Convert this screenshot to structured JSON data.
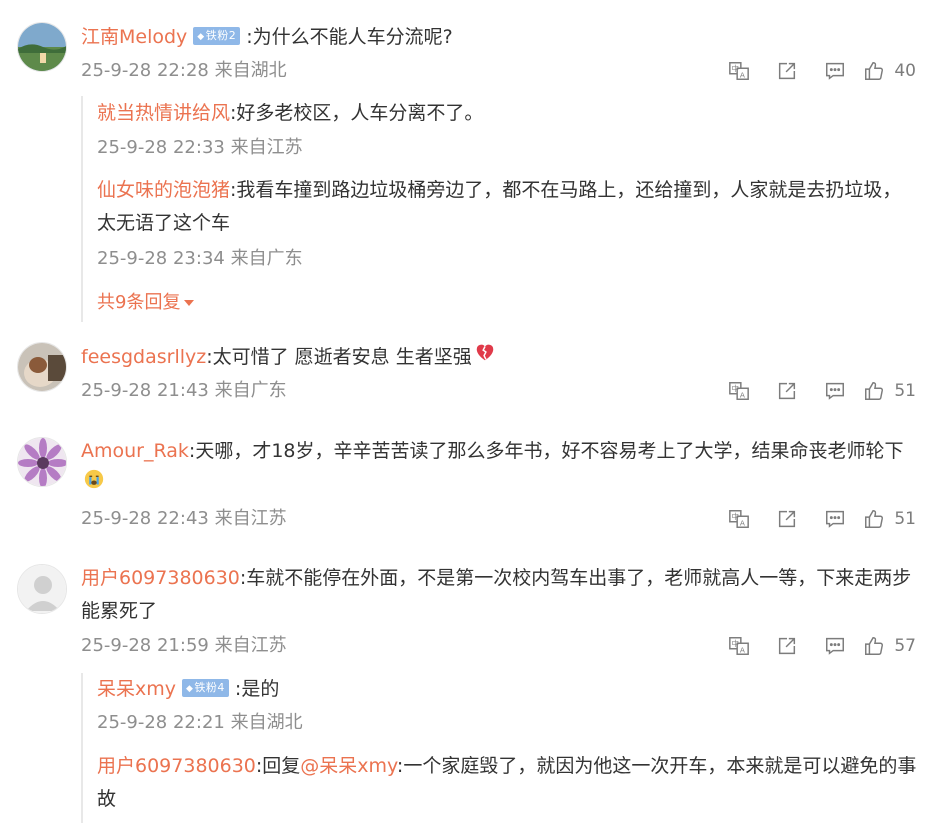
{
  "comments": [
    {
      "user": "江南Melody",
      "badge": "铁粉2",
      "text": ":为什么不能人车分流呢?",
      "time": "25-9-28 22:28",
      "location": "来自湖北",
      "likes": "40",
      "replies": [
        {
          "user": "就当热情讲给风",
          "text": ":好多老校区，人车分离不了。",
          "time": "25-9-28 22:33",
          "location": "来自江苏"
        },
        {
          "user": "仙女味的泡泡猪",
          "text": ":我看车撞到路边垃圾桶旁边了，都不在马路上，还给撞到，人家就是去扔垃圾，太无语了这个车",
          "time": "25-9-28 23:34",
          "location": "来自广东"
        }
      ],
      "more_replies": "共9条回复"
    },
    {
      "user": "feesgdasrllyz",
      "text": ":太可惜了 愿逝者安息 生者坚强",
      "emoji": "broken-heart",
      "time": "25-9-28 21:43",
      "location": "来自广东",
      "likes": "51"
    },
    {
      "user": "Amour_Rak",
      "text": ":天哪，才18岁，辛辛苦苦读了那么多年书，好不容易考上了大学，结果命丧老师轮下",
      "emoji": "crying-face",
      "time": "25-9-28 22:43",
      "location": "来自江苏",
      "likes": "51"
    },
    {
      "user": "用户6097380630",
      "text": ":车就不能停在外面，不是第一次校内驾车出事了，老师就高人一等，下来走两步能累死了",
      "time": "25-9-28 21:59",
      "location": "来自江苏",
      "likes": "57",
      "replies": [
        {
          "user": "呆呆xmy",
          "badge": "铁粉4",
          "text": ":是的",
          "time": "25-9-28 22:21",
          "location": "来自湖北"
        },
        {
          "user": "用户6097380630",
          "reply_prefix": ":回复",
          "reply_target": "@呆呆xmy",
          "text": ":一个家庭毁了，就因为他这一次开车，本来就是可以避免的事故"
        }
      ]
    }
  ],
  "icons": {
    "translate": "translate-icon",
    "share": "share-icon",
    "comment": "comment-icon",
    "like": "thumbs-up-icon"
  },
  "colors": {
    "username": "#eb7350",
    "meta": "#8e8e8e",
    "badge": "#8fb8e8"
  }
}
